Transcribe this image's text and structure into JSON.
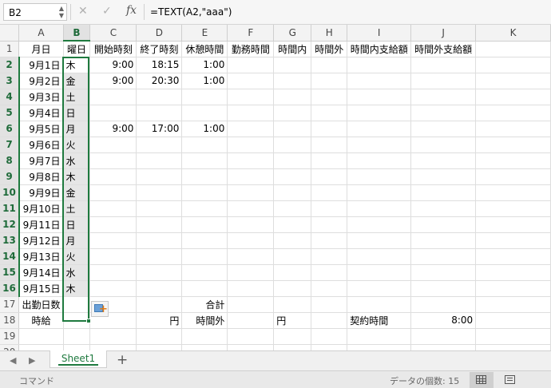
{
  "formula_bar": {
    "name_box": "B2",
    "cancel_icon": "✕",
    "confirm_icon": "✓",
    "fx_label": "fx",
    "formula": "=TEXT(A2,\"aaa\")"
  },
  "columns": [
    "A",
    "B",
    "C",
    "D",
    "E",
    "F",
    "G",
    "H",
    "I",
    "J",
    "K"
  ],
  "selected_column": "B",
  "selected_rows": [
    2,
    16
  ],
  "rows": [
    {
      "num": "1",
      "cells": [
        "月日",
        "曜日",
        "開始時刻",
        "終了時刻",
        "休憩時間",
        "勤務時間",
        "時間内",
        "時間外",
        "時間内支給額",
        "時間外支給額",
        ""
      ]
    },
    {
      "num": "2",
      "cells": [
        "9月1日",
        "木",
        "9:00",
        "18:15",
        "1:00",
        "",
        "",
        "",
        "",
        "",
        ""
      ]
    },
    {
      "num": "3",
      "cells": [
        "9月2日",
        "金",
        "9:00",
        "20:30",
        "1:00",
        "",
        "",
        "",
        "",
        "",
        ""
      ]
    },
    {
      "num": "4",
      "cells": [
        "9月3日",
        "土",
        "",
        "",
        "",
        "",
        "",
        "",
        "",
        "",
        ""
      ]
    },
    {
      "num": "5",
      "cells": [
        "9月4日",
        "日",
        "",
        "",
        "",
        "",
        "",
        "",
        "",
        "",
        ""
      ]
    },
    {
      "num": "6",
      "cells": [
        "9月5日",
        "月",
        "9:00",
        "17:00",
        "1:00",
        "",
        "",
        "",
        "",
        "",
        ""
      ]
    },
    {
      "num": "7",
      "cells": [
        "9月6日",
        "火",
        "",
        "",
        "",
        "",
        "",
        "",
        "",
        "",
        ""
      ]
    },
    {
      "num": "8",
      "cells": [
        "9月7日",
        "水",
        "",
        "",
        "",
        "",
        "",
        "",
        "",
        "",
        ""
      ]
    },
    {
      "num": "9",
      "cells": [
        "9月8日",
        "木",
        "",
        "",
        "",
        "",
        "",
        "",
        "",
        "",
        ""
      ]
    },
    {
      "num": "10",
      "cells": [
        "9月9日",
        "金",
        "",
        "",
        "",
        "",
        "",
        "",
        "",
        "",
        ""
      ]
    },
    {
      "num": "11",
      "cells": [
        "9月10日",
        "土",
        "",
        "",
        "",
        "",
        "",
        "",
        "",
        "",
        ""
      ]
    },
    {
      "num": "12",
      "cells": [
        "9月11日",
        "日",
        "",
        "",
        "",
        "",
        "",
        "",
        "",
        "",
        ""
      ]
    },
    {
      "num": "13",
      "cells": [
        "9月12日",
        "月",
        "",
        "",
        "",
        "",
        "",
        "",
        "",
        "",
        ""
      ]
    },
    {
      "num": "14",
      "cells": [
        "9月13日",
        "火",
        "",
        "",
        "",
        "",
        "",
        "",
        "",
        "",
        ""
      ]
    },
    {
      "num": "15",
      "cells": [
        "9月14日",
        "水",
        "",
        "",
        "",
        "",
        "",
        "",
        "",
        "",
        ""
      ]
    },
    {
      "num": "16",
      "cells": [
        "9月15日",
        "木",
        "",
        "",
        "",
        "",
        "",
        "",
        "",
        "",
        ""
      ]
    },
    {
      "num": "17",
      "cells": [
        "出勤日数",
        "",
        "",
        "",
        "合計",
        "",
        "",
        "",
        "",
        "",
        ""
      ]
    },
    {
      "num": "18",
      "cells": [
        "時給",
        "",
        "",
        "円",
        "時間外",
        "",
        "円",
        "",
        "契約時間",
        "8:00",
        ""
      ]
    },
    {
      "num": "19",
      "cells": [
        "",
        "",
        "",
        "",
        "",
        "",
        "",
        "",
        "",
        "",
        ""
      ]
    },
    {
      "num": "20",
      "cells": [
        "",
        "",
        "",
        "",
        "",
        "",
        "",
        "",
        "",
        "",
        ""
      ]
    }
  ],
  "sheet_tabs": {
    "prev_icon": "◀",
    "next_icon": "▶",
    "active": "Sheet1",
    "add_label": "+"
  },
  "status_bar": {
    "mode": "コマンド",
    "count": "データの個数: 15",
    "views": [
      "normal-view-icon",
      "page-layout-view-icon"
    ]
  },
  "colors": {
    "accent": "#1f7a3f",
    "selection_fill": "#e6e6e6"
  }
}
